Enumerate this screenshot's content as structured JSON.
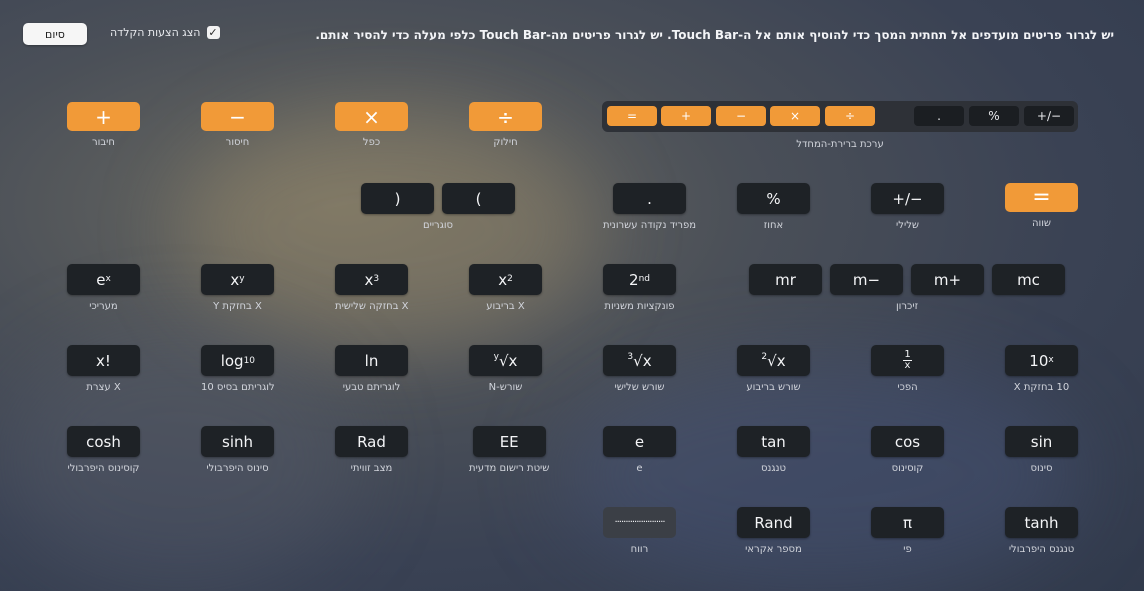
{
  "header": {
    "instruction": "יש לגרור פריטים מועדפים אל תחתית המסך כדי להוסיף אותם אל ה-Touch Bar. יש לגרור פריטים מה-Touch Bar כלפי מעלה כדי להסיר אותם.",
    "show_default_label": "הצג הצעות הקלדה",
    "show_default_checked": "✓",
    "done_label": "סיום"
  },
  "strip": {
    "label": "ערכת ברירת-המחדל",
    "keys": [
      "=",
      "+",
      "−",
      "×",
      "÷",
      ".",
      "%",
      "+∕−"
    ]
  },
  "ops": {
    "add": {
      "symbol": "+",
      "label": "חיבור"
    },
    "subtract": {
      "symbol": "−",
      "label": "חיסור"
    },
    "multiply": {
      "symbol": "×",
      "label": "כפל"
    },
    "divide": {
      "symbol": "÷",
      "label": "חילוק"
    }
  },
  "row2": {
    "equals": {
      "symbol": "=",
      "label": "שווה"
    },
    "negate": {
      "symbol": "+∕−",
      "label": "שלילי"
    },
    "percent": {
      "symbol": "%",
      "label": "אחוז"
    },
    "decimal": {
      "symbol": ".",
      "label": "מפריד נקודה עשרונית"
    },
    "parens": {
      "open": "(",
      "close": ")",
      "label": "סוגריים"
    }
  },
  "row3": {
    "memory": {
      "mc": "mc",
      "mplus": "m+",
      "mminus": "m−",
      "mr": "mr",
      "label": "זיכרון"
    },
    "second": {
      "base": "2",
      "sup": "nd",
      "label": "פונקציות משניות"
    },
    "square": {
      "base": "x",
      "sup": "2",
      "label": "X בריבוע"
    },
    "cube": {
      "base": "x",
      "sup": "3",
      "label": "X בחזקה שלישית"
    },
    "power_y": {
      "base": "x",
      "sup": "y",
      "label": "X בחזקת Y"
    },
    "exp": {
      "base": "e",
      "sup": "x",
      "label": "מעריכי"
    }
  },
  "row4": {
    "ten_pow": {
      "base": "10",
      "sup": "x",
      "label": "10 בחזקת X"
    },
    "reciprocal": {
      "num": "1",
      "den": "x",
      "label": "הפכי"
    },
    "sqrt": {
      "index": "2",
      "body": "√x",
      "label": "שורש בריבוע"
    },
    "cbrt": {
      "index": "3",
      "body": "√x",
      "label": "שורש שלישי"
    },
    "nroot": {
      "index": "y",
      "body": "√x",
      "label": "שורש-N"
    },
    "ln": {
      "symbol": "ln",
      "label": "לוגריתם טבעי"
    },
    "log10": {
      "base": "log",
      "sub": "10",
      "label": "לוגריתם בסיס 10"
    },
    "factorial": {
      "symbol": "x!",
      "label": "X עצרת"
    }
  },
  "row5": {
    "sin": {
      "symbol": "sin",
      "label": "סינוס"
    },
    "cos": {
      "symbol": "cos",
      "label": "קוסינוס"
    },
    "tan": {
      "symbol": "tan",
      "label": "טנגנס"
    },
    "e": {
      "symbol": "e",
      "label": "e"
    },
    "ee": {
      "symbol": "EE",
      "label": "שיטת רישום מדעית"
    },
    "rad": {
      "symbol": "Rad",
      "label": "מצב זוויתי"
    },
    "sinh": {
      "symbol": "sinh",
      "label": "סינוס היפרבולי"
    },
    "cosh": {
      "symbol": "cosh",
      "label": "קוסינוס היפרבולי"
    }
  },
  "row6": {
    "tanh": {
      "symbol": "tanh",
      "label": "טנגנס היפרבולי"
    },
    "pi": {
      "symbol": "π",
      "label": "פי"
    },
    "rand": {
      "symbol": "Rand",
      "label": "מספר אקראי"
    },
    "space": {
      "symbol": "·······················",
      "label": "רווח"
    }
  },
  "colors": {
    "accent": "#f19a38",
    "key_dark": "#1e2226"
  }
}
